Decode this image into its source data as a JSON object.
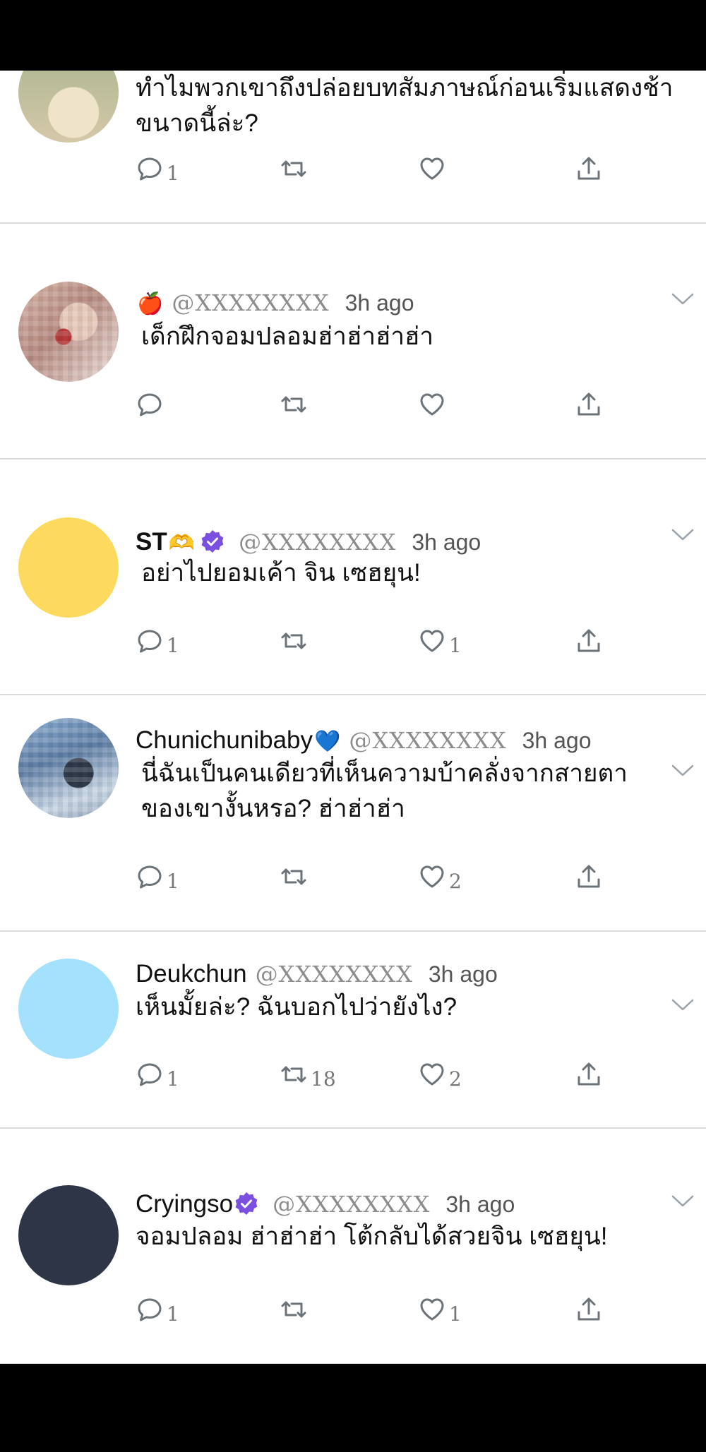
{
  "tweets": [
    {
      "name": "",
      "handle": "",
      "time": "",
      "text_lines": [
        "ทำไมพวกเขาถึงปล่อยบทสัมภาษณ์ก่อนเริ่มแสดงช้า",
        "ขนาดนี้ล่ะ?"
      ],
      "replies": "1",
      "retweets": "",
      "likes": ""
    },
    {
      "name": "",
      "emoji": "🍎",
      "handle": "@XXXXXXXX",
      "time": "3h ago",
      "text_lines": [
        "เด็กฝึกจอมปลอมฮ่าฮ่าฮ่าฮ่า"
      ],
      "replies": "",
      "retweets": "",
      "likes": ""
    },
    {
      "name": "ST",
      "emoji": "🫶",
      "verified": true,
      "handle": "@XXXXXXXX",
      "time": "3h ago",
      "text_lines": [
        "อย่าไปยอมเค้า จิน เซฮยุน!"
      ],
      "replies": "1",
      "retweets": "",
      "likes": "1",
      "avatar_color": "#FDD95E"
    },
    {
      "name": "Chunichunibaby",
      "emoji": "💙",
      "handle": "@XXXXXXXX",
      "time": "3h ago",
      "text_lines": [
        "นี่ฉันเป็นคนเดียวที่เห็นความบ้าคลั่งจากสายตา",
        "ของเขางั้นหรอ? ฮ่าฮ่าฮ่า"
      ],
      "replies": "1",
      "retweets": "",
      "likes": "2"
    },
    {
      "name": "Deukchun",
      "handle": "@XXXXXXXX",
      "time": "3h ago",
      "text_lines": [
        "เห็นมั้ยล่ะ? ฉันบอกไปว่ายังไง?"
      ],
      "replies": "1",
      "retweets": "18",
      "likes": "2",
      "avatar_color": "#A3E1FC"
    },
    {
      "name": "Cryingso",
      "verified": true,
      "handle": "@XXXXXXXX",
      "time": "3h ago",
      "text_lines": [
        "จอมปลอม ฮ่าฮ่าฮ่า โต้กลับได้สวยจิน เซฮยุน!"
      ],
      "replies": "1",
      "retweets": "",
      "likes": "1",
      "avatar_color": "#2E3547"
    }
  ],
  "colors": {
    "verified": "#7B4FE0",
    "icon": "#6B7278",
    "divider": "#DCDCDC"
  },
  "icons": {
    "reply": "comment-icon",
    "retweet": "retweet-icon",
    "like": "heart-icon",
    "share": "share-icon",
    "menu": "chevron-down-icon"
  }
}
